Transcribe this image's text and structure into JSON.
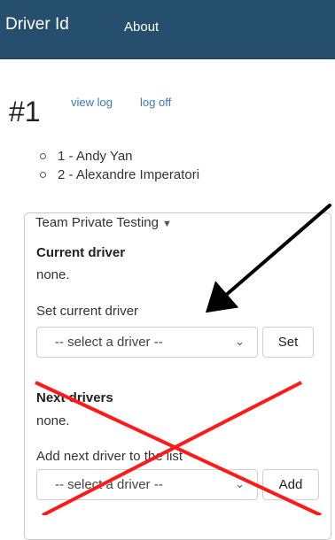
{
  "navbar": {
    "brand": "Driver Id",
    "about": "About"
  },
  "page": {
    "number": "#1",
    "view_log": "view log",
    "log_off": "log off"
  },
  "drivers": [
    {
      "label": "1 - Andy Yan"
    },
    {
      "label": "2 - Alexandre Imperatori"
    }
  ],
  "team": {
    "legend": "Team Private Testing",
    "current_driver": {
      "title": "Current driver",
      "value": "none.",
      "set_label": "Set current driver",
      "select_value": "-- select a driver --",
      "button": "Set"
    },
    "next_drivers": {
      "title": "Next drivers",
      "value": "none.",
      "add_label": "Add next driver to the list",
      "select_value": "-- select a driver --",
      "button": "Add"
    }
  },
  "annotation_colors": {
    "arrow": "#000000",
    "cross": "#ff1a1a"
  }
}
